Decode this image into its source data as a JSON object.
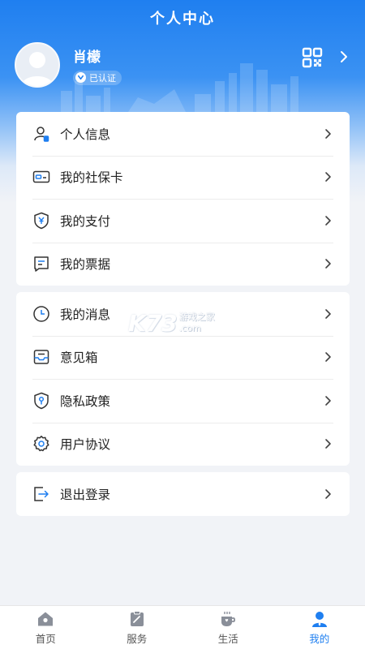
{
  "header": {
    "title": "个人中心"
  },
  "profile": {
    "name": "肖檬",
    "badge": "已认证"
  },
  "menu_group_1": [
    {
      "label": "个人信息",
      "icon": "person-id-icon"
    },
    {
      "label": "我的社保卡",
      "icon": "card-icon"
    },
    {
      "label": "我的支付",
      "icon": "shield-yuan-icon"
    },
    {
      "label": "我的票据",
      "icon": "receipt-icon"
    }
  ],
  "menu_group_2": [
    {
      "label": "我的消息",
      "icon": "clock-message-icon"
    },
    {
      "label": "意见箱",
      "icon": "inbox-icon"
    },
    {
      "label": "隐私政策",
      "icon": "shield-key-icon"
    },
    {
      "label": "用户协议",
      "icon": "gear-icon"
    }
  ],
  "menu_group_3": [
    {
      "label": "退出登录",
      "icon": "logout-icon"
    }
  ],
  "watermark": {
    "brand": "K73",
    "sub1": "游戏之家",
    "sub2": ".com"
  },
  "tabbar": [
    {
      "label": "首页",
      "icon": "home-icon"
    },
    {
      "label": "服务",
      "icon": "service-icon"
    },
    {
      "label": "生活",
      "icon": "coffee-icon"
    },
    {
      "label": "我的",
      "icon": "user-icon",
      "active": true
    }
  ],
  "colors": {
    "accent": "#1f7ff0",
    "background": "#f1f3f7"
  }
}
